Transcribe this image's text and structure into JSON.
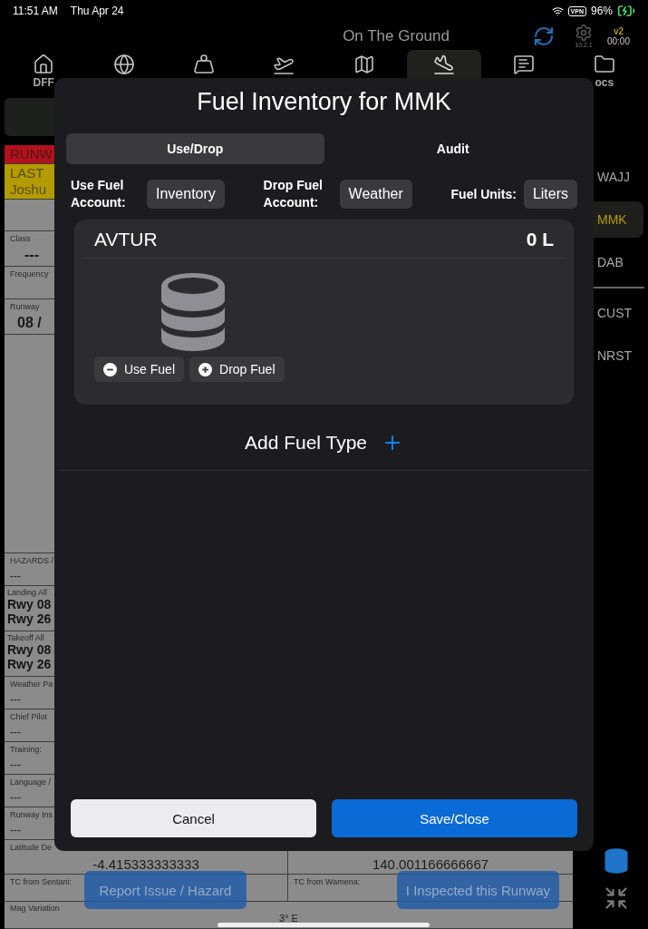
{
  "status_bar": {
    "time": "11:51 AM",
    "date": "Thu Apr 24",
    "vpn": "VPN",
    "battery": "96%"
  },
  "header": {
    "title": "On The Ground",
    "build": "10.2.1",
    "version": "v2",
    "timer": "00:00"
  },
  "nav_tabs": [
    {
      "kind": "home",
      "label": "DFF",
      "selected": false
    },
    {
      "kind": "globe",
      "selected": false
    },
    {
      "kind": "weight",
      "selected": false
    },
    {
      "kind": "departure",
      "selected": false
    },
    {
      "kind": "map",
      "selected": false
    },
    {
      "kind": "arrival",
      "selected": true
    },
    {
      "kind": "message",
      "selected": false
    },
    {
      "kind": "folder",
      "label": "ocs",
      "selected": false
    }
  ],
  "runway_panel": {
    "rows": [
      {
        "kind": "alert",
        "color": "#b3121d",
        "lines": [
          "RUNW"
        ]
      },
      {
        "kind": "alert",
        "color": "#b39b00",
        "lines": [
          "LAST",
          "Joshu"
        ]
      },
      {
        "kind": "blank"
      },
      {
        "kind": "centered",
        "label": "Class",
        "value": "---"
      },
      {
        "kind": "plain",
        "label": "Frequency"
      },
      {
        "kind": "centered",
        "label": "Runway",
        "value": "08 /"
      },
      {
        "kind": "fill"
      },
      {
        "kind": "plain",
        "label": "HAZARDS /",
        "value": "---"
      },
      {
        "kind": "list",
        "label": "Landing All",
        "lines": [
          "Rwy 08",
          "Rwy 26"
        ]
      },
      {
        "kind": "list",
        "label": "Takeoff All",
        "lines": [
          "Rwy 08",
          "Rwy 26"
        ]
      },
      {
        "kind": "plain",
        "label": "Weather Pa",
        "value": "---"
      },
      {
        "kind": "plain",
        "label": "Chief Pilot",
        "value": "---"
      },
      {
        "kind": "plain",
        "label": "Training:",
        "value": "---"
      },
      {
        "kind": "plain",
        "label": "Language /",
        "value": "---"
      },
      {
        "kind": "plain",
        "label": "Runway Ins",
        "value": "---"
      },
      {
        "kind": "split",
        "cells": [
          {
            "label": "Latitude De",
            "value": "-4.415333333333"
          },
          {
            "value": "140.001166666667"
          }
        ]
      },
      {
        "kind": "split",
        "cells": [
          {
            "label": "TC from Sentani:"
          },
          {
            "label": "TC from Wamena:"
          }
        ]
      },
      {
        "kind": "wide",
        "label": "Mag Variation",
        "value": "3° E"
      }
    ],
    "buttons": [
      "Report Issue / Hazard",
      "I Inspected this Runway"
    ]
  },
  "sidebar": {
    "airports": [
      {
        "code": "WAJJ",
        "selected": false
      },
      {
        "code": "MMK",
        "selected": true
      },
      {
        "code": "DAB",
        "selected": false
      }
    ],
    "lists": [
      {
        "label": "CUST",
        "selected": false
      },
      {
        "label": "NRST",
        "selected": false
      }
    ]
  },
  "modal": {
    "title": "Fuel Inventory for MMK",
    "tabs": [
      {
        "label": "Use/Drop",
        "selected": true
      },
      {
        "label": "Audit",
        "selected": false
      }
    ],
    "settings": [
      {
        "label": "Use Fuel Account:",
        "value": "Inventory"
      },
      {
        "label": "Drop Fuel Account:",
        "value": "Weather"
      },
      {
        "label": "Fuel Units:",
        "value": "Liters"
      }
    ],
    "fuel_types": [
      {
        "name": "AVTUR",
        "amount": "0 L",
        "actions": [
          {
            "kind": "use",
            "label": "Use Fuel"
          },
          {
            "kind": "drop",
            "label": "Drop Fuel"
          }
        ]
      }
    ],
    "add_label": "Add Fuel Type",
    "buttons": [
      {
        "kind": "cancel",
        "label": "Cancel"
      },
      {
        "kind": "save",
        "label": "Save/Close"
      }
    ]
  }
}
